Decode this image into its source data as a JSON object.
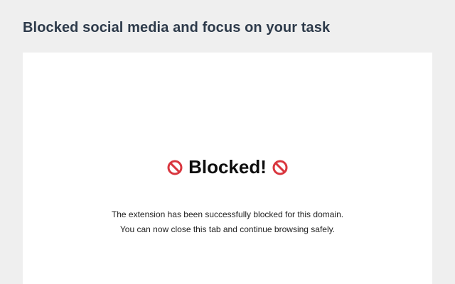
{
  "header": {
    "title": "Blocked social media and focus on your task"
  },
  "card": {
    "heading": "Blocked!",
    "left_icon": "no-entry-icon",
    "right_icon": "no-entry-icon",
    "icon_color": "#d9363e",
    "message_line1": "The extension has been successfully blocked for this domain.",
    "message_line2": "You can now close this tab and continue browsing safely."
  }
}
